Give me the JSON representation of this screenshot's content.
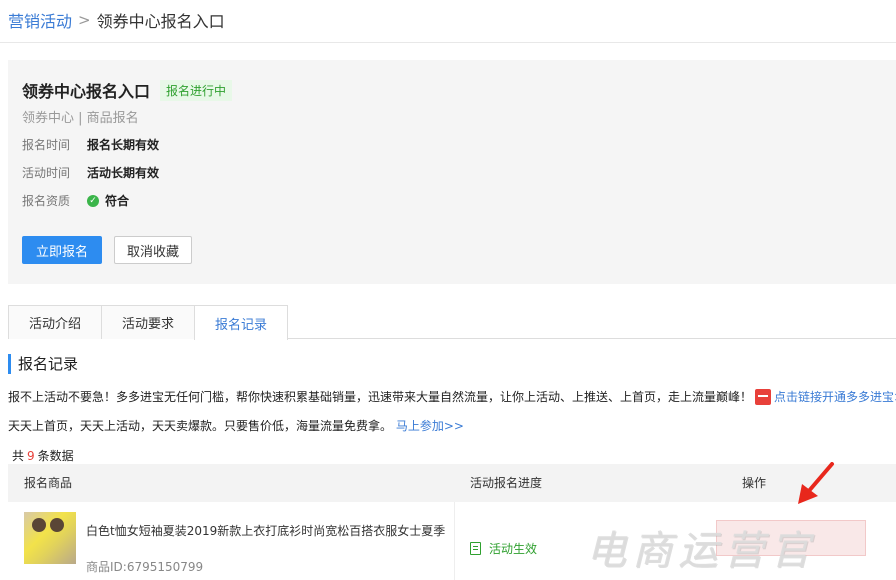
{
  "breadcrumb": {
    "root": "营销活动",
    "separator": ">",
    "current": "领券中心报名入口"
  },
  "activity": {
    "title": "领券中心报名入口",
    "status": "报名进行中",
    "subtitle": "领券中心 | 商品报名",
    "fields": [
      {
        "label": "报名时间",
        "value": "报名长期有效"
      },
      {
        "label": "活动时间",
        "value": "活动长期有效"
      },
      {
        "label": "报名资质",
        "value": "符合"
      }
    ],
    "primary_button": "立即报名",
    "secondary_button": "取消收藏"
  },
  "tabs": [
    "活动介绍",
    "活动要求",
    "报名记录"
  ],
  "active_tab": 2,
  "section_title": "报名记录",
  "promo": {
    "line1": "报不上活动不要急！多多进宝无任何门槛，帮你快速积累基础销量，迅速带来大量自然流量，让你上活动、上推送、上首页，走上流量巅峰！",
    "line1_link": "点击链接开通多多进宝>>",
    "line2": "天天上首页，天天上活动，天天卖爆款。只要售价低，海量流量免费拿。",
    "line2_link": "马上参加>>"
  },
  "count": {
    "prefix": "共",
    "number": "9",
    "suffix": "条数据"
  },
  "table": {
    "headers": [
      "报名商品",
      "活动报名进度",
      "操作"
    ],
    "rows": [
      {
        "product_name": "白色t恤女短袖夏装2019新款上衣打底衫时尚宽松百搭衣服女士夏季",
        "product_id": "商品ID:6795150799",
        "progress": "活动生效"
      }
    ]
  },
  "watermark": "电商运营官",
  "colors": {
    "accent": "#2d8cf0",
    "link": "#3a7bd5",
    "success": "#2fa02f",
    "alert": "#e8403a"
  }
}
